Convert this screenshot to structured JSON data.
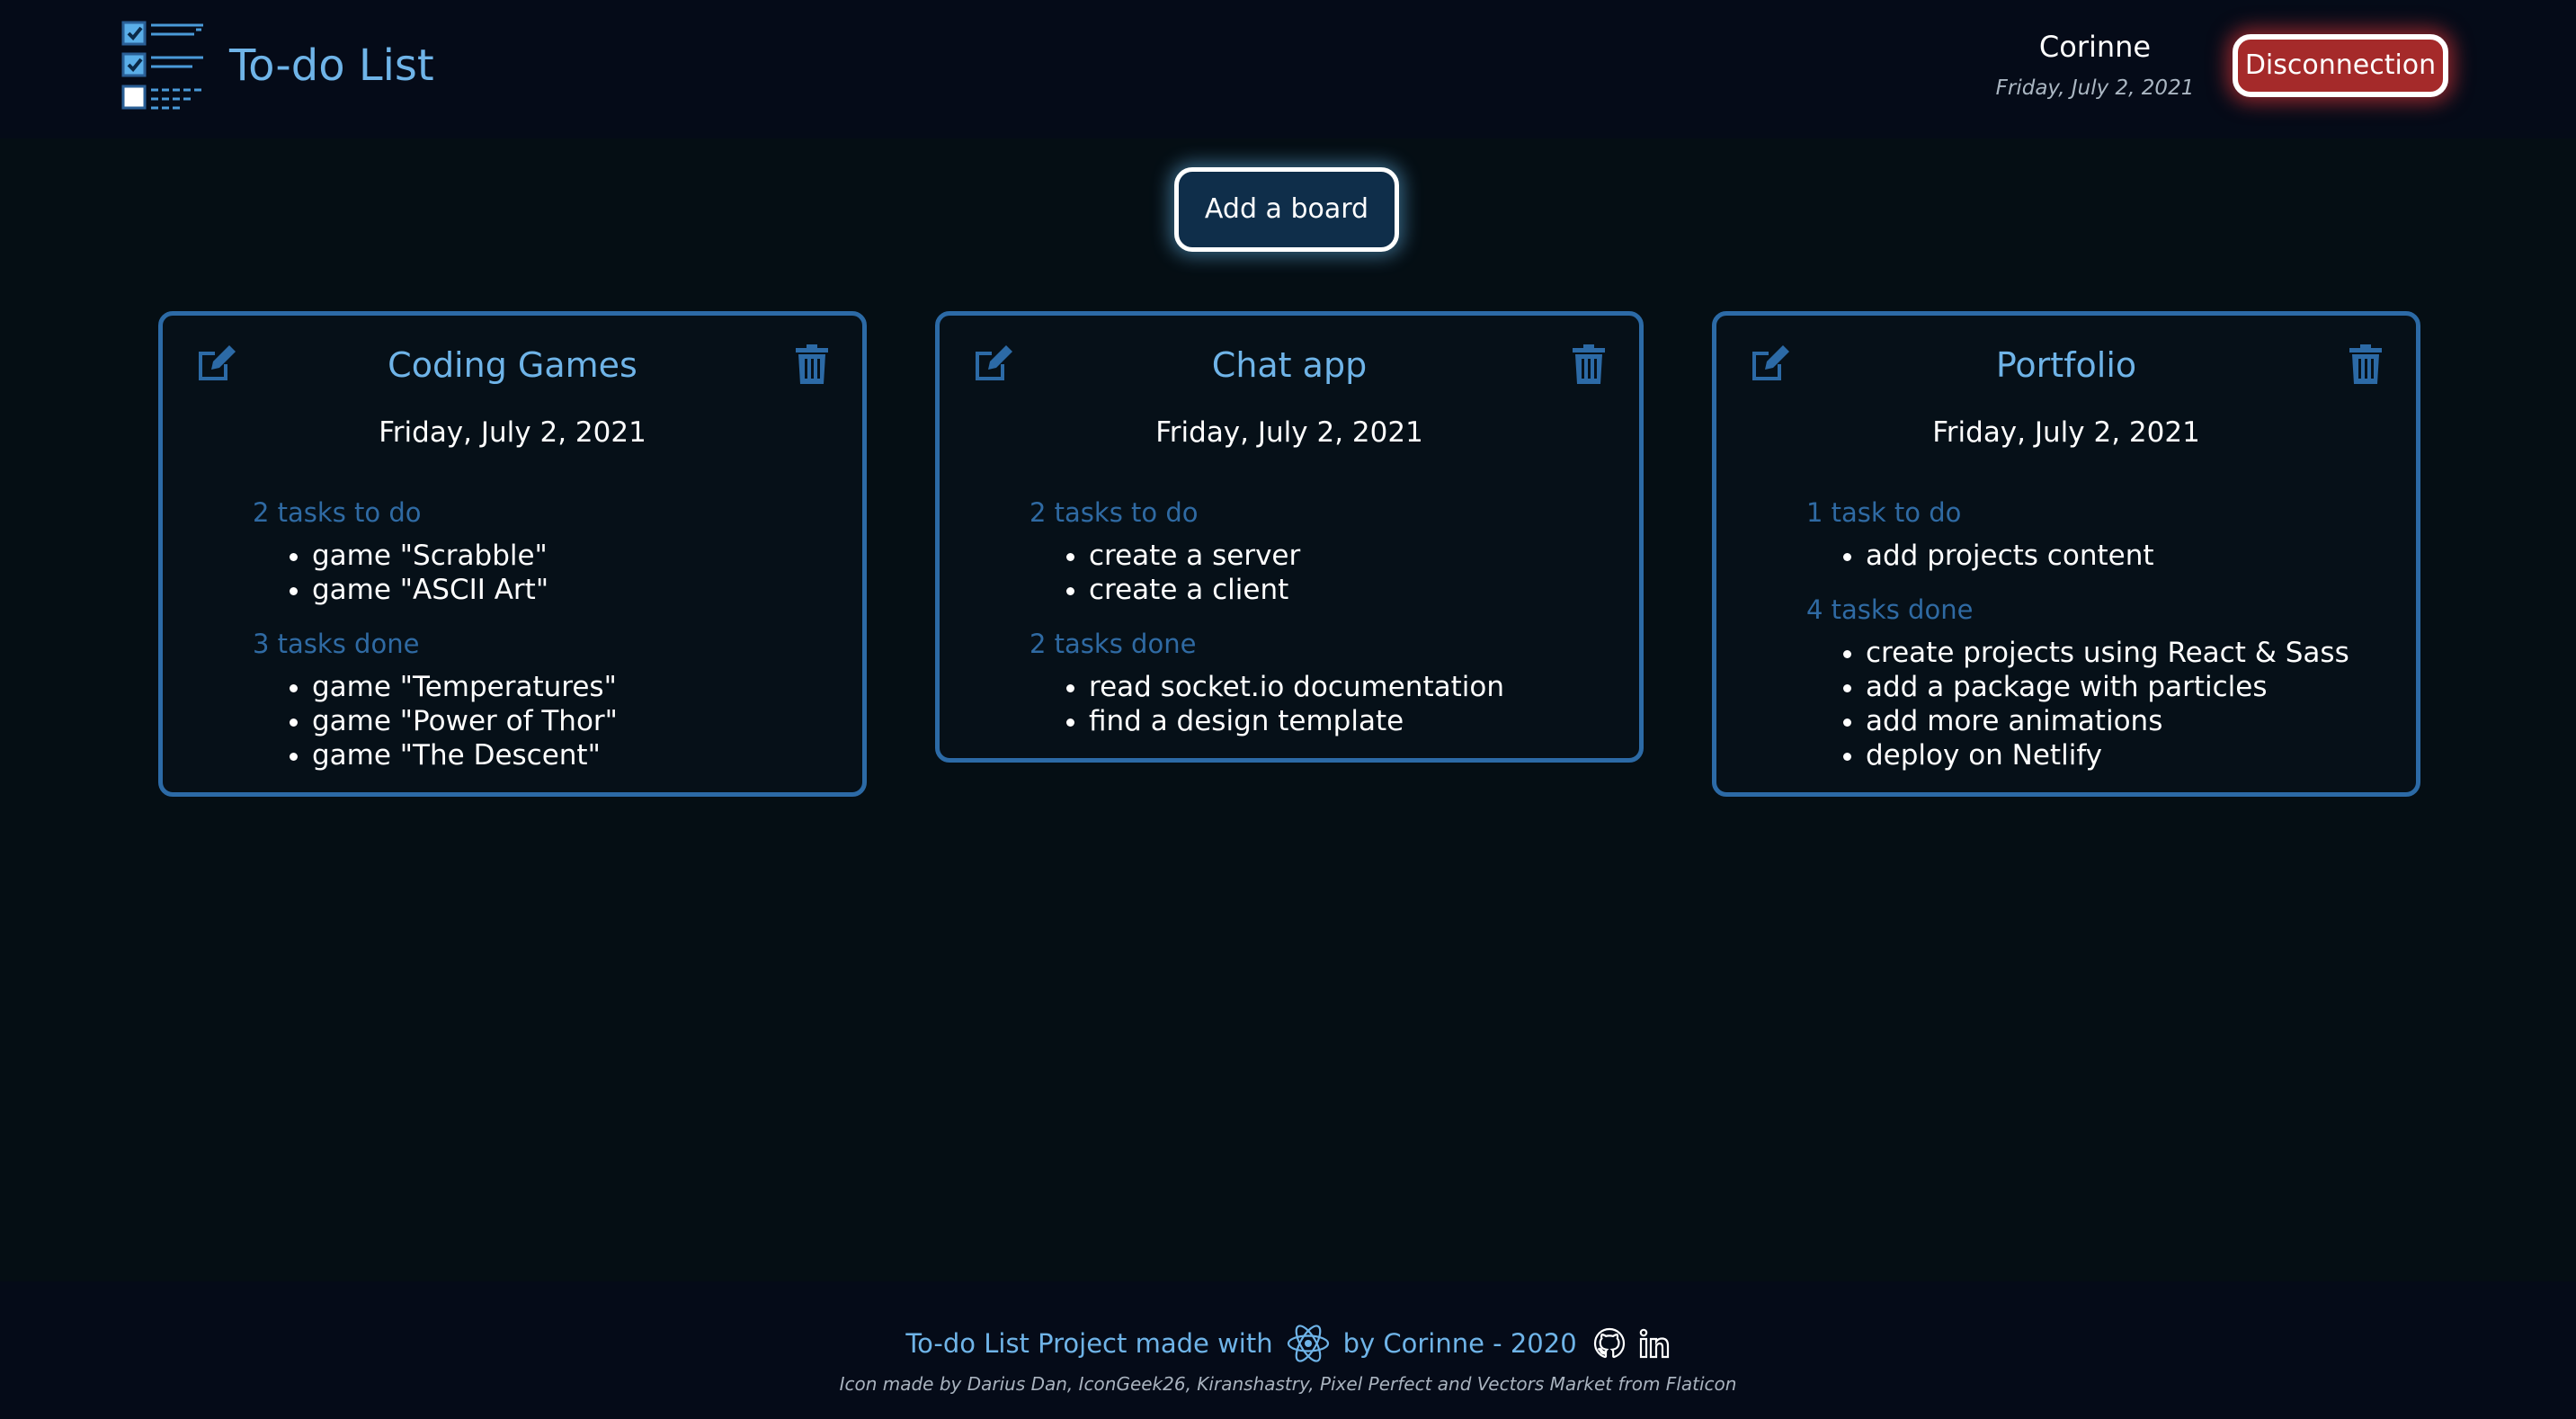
{
  "header": {
    "app_title": "To-do List",
    "user_name": "Corinne",
    "user_date": "Friday, July 2, 2021",
    "disconnect_label": "Disconnection",
    "logo_icon": "checklist-icon"
  },
  "toolbar": {
    "add_board_label": "Add a board"
  },
  "boards": [
    {
      "title": "Coding Games",
      "date": "Friday, July 2, 2021",
      "todo_label": "2 tasks to do",
      "todo": [
        "game \"Scrabble\"",
        "game \"ASCII Art\""
      ],
      "done_label": "3 tasks done",
      "done": [
        "game \"Temperatures\"",
        "game \"Power of Thor\"",
        "game \"The Descent\""
      ]
    },
    {
      "title": "Chat app",
      "date": "Friday, July 2, 2021",
      "todo_label": "2 tasks to do",
      "todo": [
        "create a server",
        "create a client"
      ],
      "done_label": "2 tasks done",
      "done": [
        "read socket.io documentation",
        "find a design template"
      ]
    },
    {
      "title": "Portfolio",
      "date": "Friday, July 2, 2021",
      "todo_label": "1 task to do",
      "todo": [
        "add projects content"
      ],
      "done_label": "4 tasks done",
      "done": [
        "create projects using React & Sass",
        "add a package with particles",
        "add more animations",
        "deploy on Netlify"
      ]
    }
  ],
  "footer": {
    "made_with": "To-do List Project made with",
    "by_line": "by Corinne - 2020",
    "credits": "Icon made by Darius Dan, IconGeek26, Kiranshastry, Pixel Perfect and Vectors Market from Flaticon",
    "icons": [
      "react-icon",
      "github-icon",
      "linkedin-icon"
    ]
  },
  "colors": {
    "background": "#050e14",
    "header_bg": "#050b18",
    "accent": "#6fb4e8",
    "board_border": "#2c6aa6",
    "section_label": "#2f6aa3",
    "danger": "#a52a2a",
    "add_board_bg": "#0f2e4a"
  }
}
